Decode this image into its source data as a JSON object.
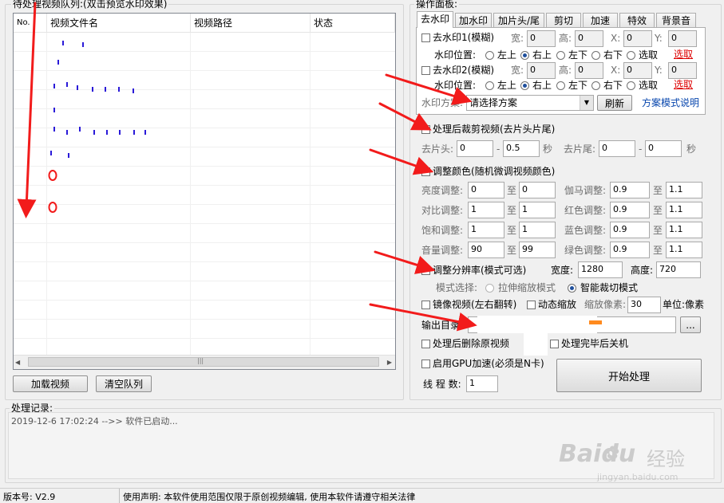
{
  "queue": {
    "title": "待处理视频队列:(双击预览水印效果)",
    "columns": [
      "No.",
      "视频文件名",
      "视频路径",
      "状态"
    ],
    "load_button": "加载视频",
    "clear_button": "清空队列"
  },
  "panel": {
    "title": "操作面板:",
    "tabs": [
      "去水印",
      "加水印",
      "加片头/尾",
      "剪切",
      "加速",
      "特效",
      "背景音"
    ],
    "wm1": {
      "label": "去水印1(模糊)",
      "w": "0",
      "h": "0",
      "x": "0",
      "y": "0"
    },
    "wm2": {
      "label": "去水印2(模糊)",
      "w": "0",
      "h": "0",
      "x": "0",
      "y": "0"
    },
    "field_labels": {
      "w": "宽:",
      "h": "高:",
      "x": "X:",
      "y": "Y:"
    },
    "position_label": "水印位置:",
    "positions": [
      "左上",
      "右上",
      "左下",
      "右下",
      "选取"
    ],
    "pick_link": "选取",
    "scheme_label": "水印方案:",
    "scheme_value": "请选择方案",
    "refresh_button": "刷新",
    "scheme_help": "方案模式说明"
  },
  "trim": {
    "label": "处理后裁剪视频(去片头片尾)",
    "head_label": "去片头:",
    "head_from": "0",
    "head_to": "0.5",
    "tail_label": "去片尾:",
    "tail_from": "0",
    "tail_to": "0",
    "sep": "-",
    "unit": "秒"
  },
  "color": {
    "label": "调整颜色(随机微调视频颜色)",
    "to": "至",
    "rows": [
      {
        "left_label": "亮度调整:",
        "l_from": "0",
        "l_to": "0",
        "right_label": "伽马调整:",
        "r_from": "0.9",
        "r_to": "1.1"
      },
      {
        "left_label": "对比调整:",
        "l_from": "1",
        "l_to": "1",
        "right_label": "红色调整:",
        "r_from": "0.9",
        "r_to": "1.1"
      },
      {
        "left_label": "饱和调整:",
        "l_from": "1",
        "l_to": "1",
        "right_label": "蓝色调整:",
        "r_from": "0.9",
        "r_to": "1.1"
      },
      {
        "left_label": "音量调整:",
        "l_from": "90",
        "l_to": "99",
        "right_label": "绿色调整:",
        "r_from": "0.9",
        "r_to": "1.1"
      }
    ]
  },
  "resolution": {
    "label": "调整分辨率(模式可选)",
    "width_label": "宽度:",
    "width": "1280",
    "height_label": "高度:",
    "height": "720",
    "mode_label": "模式选择:",
    "mode_stretch": "拉伸缩放模式",
    "mode_crop": "智能裁切模式"
  },
  "mirror_label": "镜像视频(左右翻转)",
  "zoom": {
    "label": "动态缩放",
    "pixels_label": "缩放像素:",
    "pixels": "30",
    "unit_label": "单位:像素"
  },
  "output": {
    "label": "输出目录:",
    "value": "",
    "browse": "..."
  },
  "delete_original": "处理后删除原视频",
  "shutdown": "处理完毕后关机",
  "gpu": "启用GPU加速(必须是N卡)",
  "threads": {
    "label": "线 程 数:",
    "value": "1"
  },
  "start_button": "开始处理",
  "log": {
    "title": "处理记录:",
    "entry": "2019-12-6 17:02:24 -->> 软件已启动..."
  },
  "status": {
    "version": "版本号: V2.9",
    "notice": "使用声明: 本软件使用范围仅限于原创视频编辑, 使用本软件请遵守相关法律"
  },
  "watermark": {
    "brand": "Baidu",
    "brand_cn": "经验",
    "url": "jingyan.baidu.com"
  },
  "colors": {
    "arrow": "#f21b1b",
    "link": "#0645ad",
    "pick": "#dd0000",
    "mark": "#2a1ad8"
  }
}
